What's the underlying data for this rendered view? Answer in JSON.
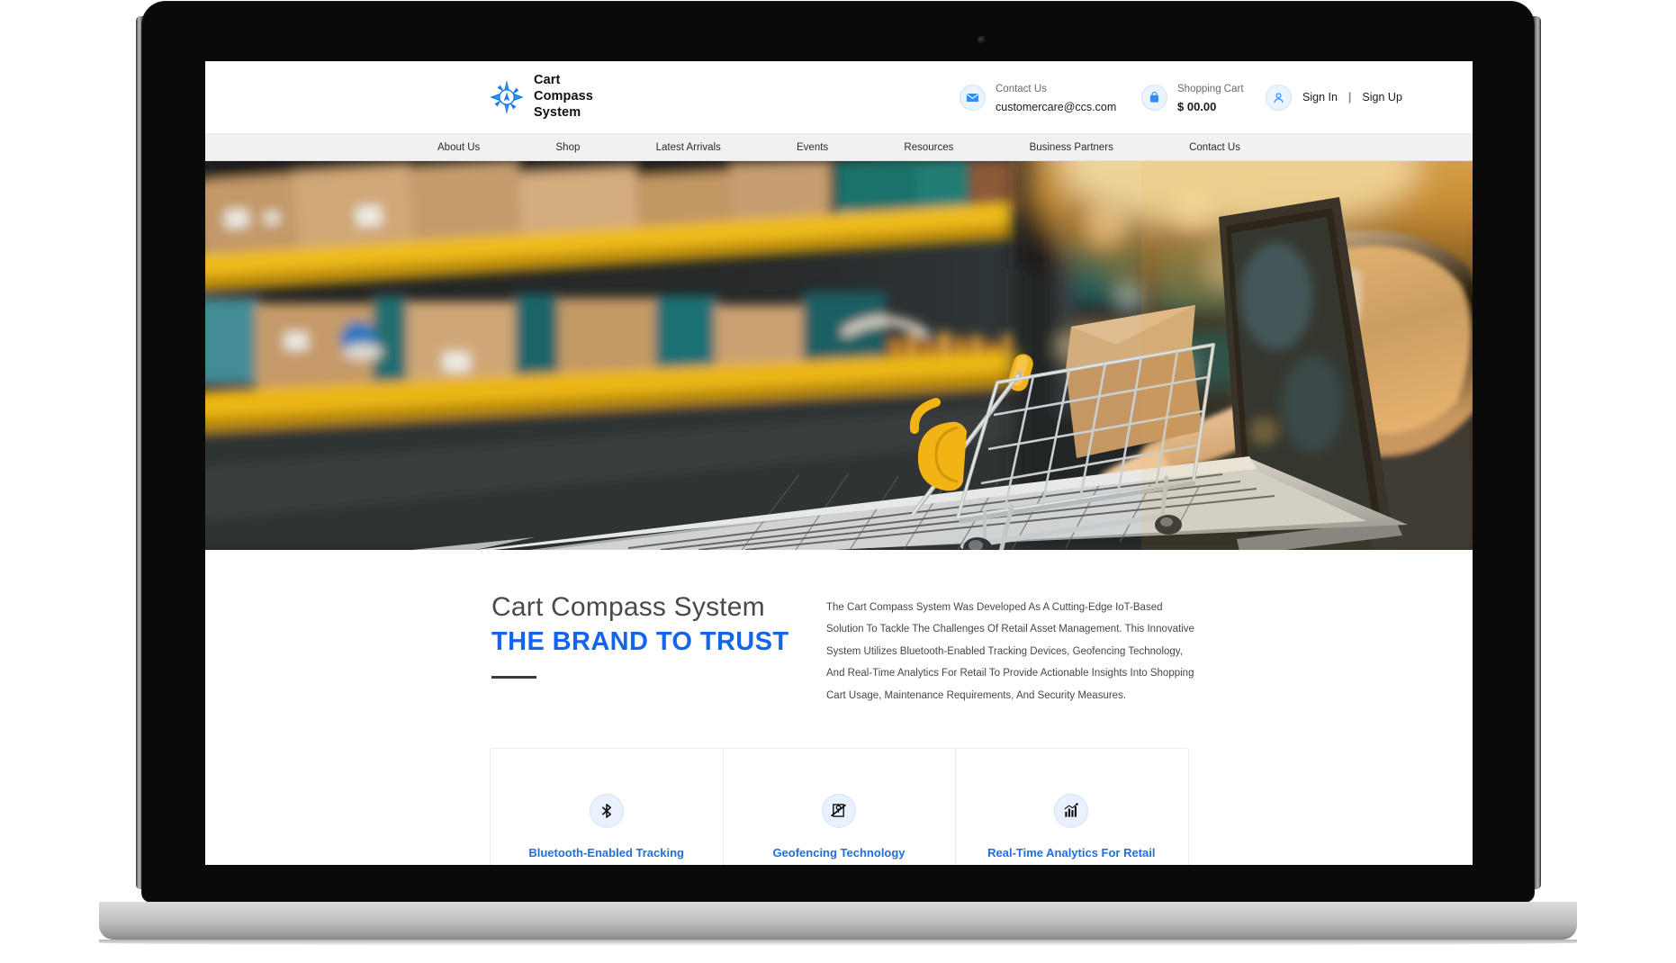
{
  "brand": {
    "logo_icon": "compass-star-icon",
    "name_lines": [
      "Cart",
      "Compass",
      "System"
    ],
    "accent_color": "#1565ea"
  },
  "header": {
    "contact": {
      "icon": "envelope-icon",
      "label": "Contact Us",
      "email": "customercare@ccs.com"
    },
    "cart": {
      "icon": "shopping-bag-icon",
      "label": "Shopping Cart",
      "amount": "$ 00.00"
    },
    "auth": {
      "icon": "user-avatar-icon",
      "sign_in": "Sign In",
      "separator": "|",
      "sign_up": "Sign Up"
    }
  },
  "nav": {
    "items": [
      {
        "label": "About Us"
      },
      {
        "label": "Shop"
      },
      {
        "label": "Latest Arrivals"
      },
      {
        "label": "Events"
      },
      {
        "label": "Resources"
      },
      {
        "label": "Business Partners"
      },
      {
        "label": "Contact Us"
      }
    ]
  },
  "hero": {
    "alt": "Miniature shopping cart with cardboard box sitting on a laptop keyboard inside a warehouse aisle, person typing"
  },
  "intro": {
    "heading": "Cart Compass System",
    "subheading": "THE BRAND TO TRUST",
    "paragraph": "The Cart Compass System Was Developed As A Cutting-Edge IoT-Based Solution To Tackle The Challenges Of Retail Asset Management. This Innovative System Utilizes Bluetooth-Enabled Tracking Devices, Geofencing Technology, And Real-Time Analytics For Retail To Provide Actionable Insights Into Shopping Cart Usage, Maintenance Requirements, And Security Measures."
  },
  "features": [
    {
      "icon": "bluetooth-icon",
      "label": "Bluetooth-Enabled Tracking"
    },
    {
      "icon": "geofencing-map-pin-icon",
      "label": "Geofencing Technology"
    },
    {
      "icon": "analytics-bar-chart-icon",
      "label": "Real-Time Analytics For Retail"
    }
  ]
}
